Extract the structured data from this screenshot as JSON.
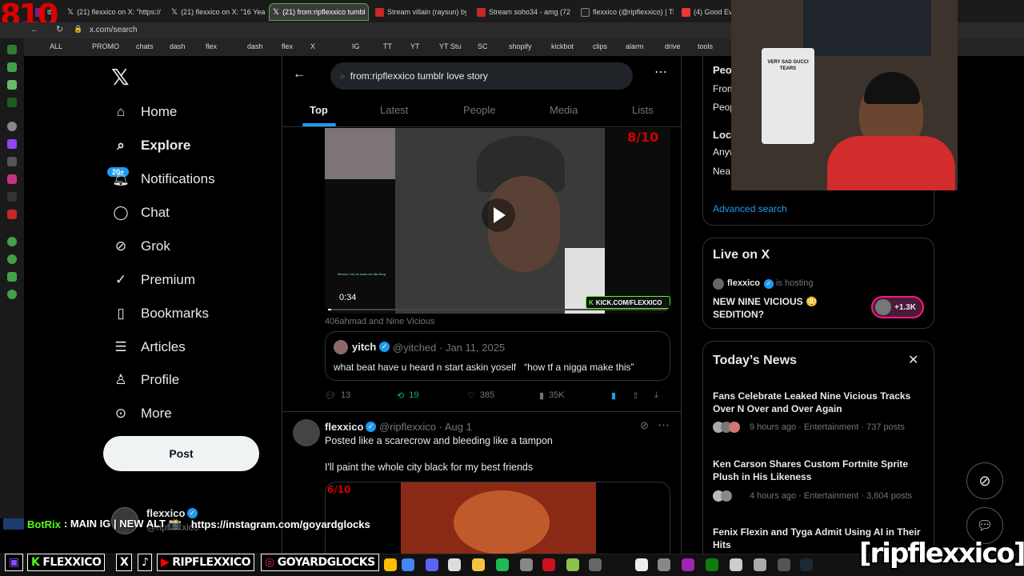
{
  "overlay_text": "810",
  "browser": {
    "tabs": [
      {
        "label": "tbt"
      },
      {
        "label": "(21) flexxico on X: \"https://"
      },
      {
        "label": "(21) flexxico on X: \"16 Yea"
      },
      {
        "label": "(21) from:ripflexxico tumbl"
      },
      {
        "label": "Stream villain (raysun) by"
      },
      {
        "label": "Stream soho34 - amg (72"
      },
      {
        "label": "flexxico (@ripflexxico) | Ti"
      },
      {
        "label": "(4) Good Eve"
      }
    ],
    "url": "x.com/search",
    "bookmarks": [
      "ALL",
      "PROMO",
      "chats",
      "dash",
      "flex",
      "dash",
      "flex",
      "X",
      "IG",
      "TT",
      "YT",
      "YT Stu",
      "SC",
      "shopify",
      "kickbot",
      "clips",
      "alarm",
      "drive",
      "tools"
    ]
  },
  "nav": {
    "items": [
      {
        "label": "Home",
        "icon": "home-icon"
      },
      {
        "label": "Explore",
        "icon": "search-icon"
      },
      {
        "label": "Notifications",
        "icon": "bell-icon",
        "badge": "20+"
      },
      {
        "label": "Chat",
        "icon": "chat-icon"
      },
      {
        "label": "Grok",
        "icon": "grok-icon"
      },
      {
        "label": "Premium",
        "icon": "premium-icon"
      },
      {
        "label": "Bookmarks",
        "icon": "bookmark-icon"
      },
      {
        "label": "Articles",
        "icon": "articles-icon"
      },
      {
        "label": "Profile",
        "icon": "profile-icon"
      },
      {
        "label": "More",
        "icon": "more-icon"
      }
    ],
    "post_label": "Post",
    "account": {
      "name": "flexxico",
      "handle": "@ripflexxico"
    }
  },
  "search": {
    "query": "from:ripflexxico tumblr love story",
    "tabs": [
      "Top",
      "Latest",
      "People",
      "Media",
      "Lists"
    ],
    "active_tab": "Top"
  },
  "tweet1": {
    "video_time": "0:34",
    "video_rating": "8/10",
    "video_watermark": "KICK.COM/FLEXXICO",
    "video_caption": "flexxico: bro he looks sm like thug",
    "tagged": "406ahmad and Nine Vicious",
    "quote": {
      "name": "yitch",
      "handle": "@yitched",
      "date": "Jan 11, 2025",
      "text": "what beat have u heard n start askin yoself   “how tf a nigga make this”"
    },
    "stats": {
      "replies": "13",
      "retweets": "19",
      "likes": "385",
      "views": "35K"
    }
  },
  "tweet2": {
    "name": "flexxico",
    "handle": "@ripflexxico",
    "date": "Aug 1",
    "line1": "Posted like a scarecrow and bleeding like a tampon",
    "line2": "I'll paint the whole city black for my best friends",
    "image_rating": "6/10"
  },
  "right": {
    "search_filters": {
      "people_label": "Peo",
      "from_label": "From",
      "people2": "Peop",
      "location_label": "Loca",
      "anywhere": "Anyw",
      "near": "Nea"
    },
    "advanced_search": "Advanced search",
    "live": {
      "title": "Live on X",
      "host": "flexxico",
      "hosting": "is hosting",
      "space_title": "NEW NINE VICIOUS 😳 SEDITION?",
      "listeners": "+1.3K"
    },
    "news": {
      "title": "Today’s News",
      "items": [
        {
          "headline": "Fans Celebrate Leaked Nine Vicious Tracks Over N Over and Over Again",
          "meta": "9 hours ago · Entertainment · 737 posts"
        },
        {
          "headline": "Ken Carson Shares Custom Fortnite Sprite Plush in His Likeness",
          "meta": "4 hours ago · Entertainment · 3,604 posts"
        },
        {
          "headline": "Fenix Flexin and Tyga Admit Using AI in Their Hits",
          "meta": ""
        }
      ]
    }
  },
  "webcam": {
    "shirt_text": "VERY SAD GUCCI TEARS"
  },
  "chat_overlay": {
    "user": "BotRix",
    "text": ": MAIN IG  |  NEW ALT 📸",
    "link": "https://instagram.com/goyardglocks"
  },
  "stream_bar": {
    "kick": "FLEXXICO",
    "x": "X",
    "youtube": "RIPFLEXXICO",
    "instagram": "GOYARDGLOCKS",
    "handle_overlay": "[ripflexxico]"
  },
  "colors": {
    "accent": "#1d9bf0",
    "retweet": "#00ba7c",
    "bg": "#000000",
    "kick": "#53fc18"
  }
}
